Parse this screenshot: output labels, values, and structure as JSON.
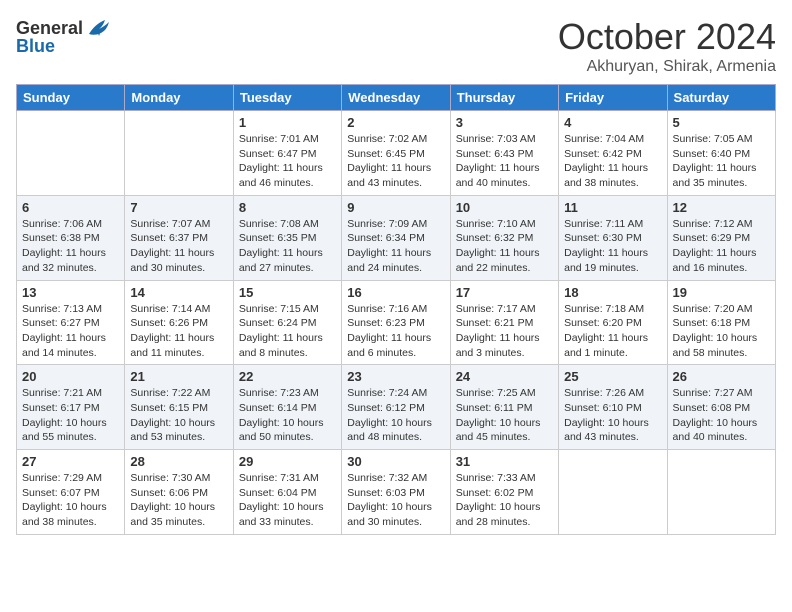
{
  "header": {
    "logo_general": "General",
    "logo_blue": "Blue",
    "month_title": "October 2024",
    "location": "Akhuryan, Shirak, Armenia"
  },
  "columns": [
    "Sunday",
    "Monday",
    "Tuesday",
    "Wednesday",
    "Thursday",
    "Friday",
    "Saturday"
  ],
  "weeks": [
    [
      {
        "day": "",
        "sunrise": "",
        "sunset": "",
        "daylight": ""
      },
      {
        "day": "",
        "sunrise": "",
        "sunset": "",
        "daylight": ""
      },
      {
        "day": "1",
        "sunrise": "Sunrise: 7:01 AM",
        "sunset": "Sunset: 6:47 PM",
        "daylight": "Daylight: 11 hours and 46 minutes."
      },
      {
        "day": "2",
        "sunrise": "Sunrise: 7:02 AM",
        "sunset": "Sunset: 6:45 PM",
        "daylight": "Daylight: 11 hours and 43 minutes."
      },
      {
        "day": "3",
        "sunrise": "Sunrise: 7:03 AM",
        "sunset": "Sunset: 6:43 PM",
        "daylight": "Daylight: 11 hours and 40 minutes."
      },
      {
        "day": "4",
        "sunrise": "Sunrise: 7:04 AM",
        "sunset": "Sunset: 6:42 PM",
        "daylight": "Daylight: 11 hours and 38 minutes."
      },
      {
        "day": "5",
        "sunrise": "Sunrise: 7:05 AM",
        "sunset": "Sunset: 6:40 PM",
        "daylight": "Daylight: 11 hours and 35 minutes."
      }
    ],
    [
      {
        "day": "6",
        "sunrise": "Sunrise: 7:06 AM",
        "sunset": "Sunset: 6:38 PM",
        "daylight": "Daylight: 11 hours and 32 minutes."
      },
      {
        "day": "7",
        "sunrise": "Sunrise: 7:07 AM",
        "sunset": "Sunset: 6:37 PM",
        "daylight": "Daylight: 11 hours and 30 minutes."
      },
      {
        "day": "8",
        "sunrise": "Sunrise: 7:08 AM",
        "sunset": "Sunset: 6:35 PM",
        "daylight": "Daylight: 11 hours and 27 minutes."
      },
      {
        "day": "9",
        "sunrise": "Sunrise: 7:09 AM",
        "sunset": "Sunset: 6:34 PM",
        "daylight": "Daylight: 11 hours and 24 minutes."
      },
      {
        "day": "10",
        "sunrise": "Sunrise: 7:10 AM",
        "sunset": "Sunset: 6:32 PM",
        "daylight": "Daylight: 11 hours and 22 minutes."
      },
      {
        "day": "11",
        "sunrise": "Sunrise: 7:11 AM",
        "sunset": "Sunset: 6:30 PM",
        "daylight": "Daylight: 11 hours and 19 minutes."
      },
      {
        "day": "12",
        "sunrise": "Sunrise: 7:12 AM",
        "sunset": "Sunset: 6:29 PM",
        "daylight": "Daylight: 11 hours and 16 minutes."
      }
    ],
    [
      {
        "day": "13",
        "sunrise": "Sunrise: 7:13 AM",
        "sunset": "Sunset: 6:27 PM",
        "daylight": "Daylight: 11 hours and 14 minutes."
      },
      {
        "day": "14",
        "sunrise": "Sunrise: 7:14 AM",
        "sunset": "Sunset: 6:26 PM",
        "daylight": "Daylight: 11 hours and 11 minutes."
      },
      {
        "day": "15",
        "sunrise": "Sunrise: 7:15 AM",
        "sunset": "Sunset: 6:24 PM",
        "daylight": "Daylight: 11 hours and 8 minutes."
      },
      {
        "day": "16",
        "sunrise": "Sunrise: 7:16 AM",
        "sunset": "Sunset: 6:23 PM",
        "daylight": "Daylight: 11 hours and 6 minutes."
      },
      {
        "day": "17",
        "sunrise": "Sunrise: 7:17 AM",
        "sunset": "Sunset: 6:21 PM",
        "daylight": "Daylight: 11 hours and 3 minutes."
      },
      {
        "day": "18",
        "sunrise": "Sunrise: 7:18 AM",
        "sunset": "Sunset: 6:20 PM",
        "daylight": "Daylight: 11 hours and 1 minute."
      },
      {
        "day": "19",
        "sunrise": "Sunrise: 7:20 AM",
        "sunset": "Sunset: 6:18 PM",
        "daylight": "Daylight: 10 hours and 58 minutes."
      }
    ],
    [
      {
        "day": "20",
        "sunrise": "Sunrise: 7:21 AM",
        "sunset": "Sunset: 6:17 PM",
        "daylight": "Daylight: 10 hours and 55 minutes."
      },
      {
        "day": "21",
        "sunrise": "Sunrise: 7:22 AM",
        "sunset": "Sunset: 6:15 PM",
        "daylight": "Daylight: 10 hours and 53 minutes."
      },
      {
        "day": "22",
        "sunrise": "Sunrise: 7:23 AM",
        "sunset": "Sunset: 6:14 PM",
        "daylight": "Daylight: 10 hours and 50 minutes."
      },
      {
        "day": "23",
        "sunrise": "Sunrise: 7:24 AM",
        "sunset": "Sunset: 6:12 PM",
        "daylight": "Daylight: 10 hours and 48 minutes."
      },
      {
        "day": "24",
        "sunrise": "Sunrise: 7:25 AM",
        "sunset": "Sunset: 6:11 PM",
        "daylight": "Daylight: 10 hours and 45 minutes."
      },
      {
        "day": "25",
        "sunrise": "Sunrise: 7:26 AM",
        "sunset": "Sunset: 6:10 PM",
        "daylight": "Daylight: 10 hours and 43 minutes."
      },
      {
        "day": "26",
        "sunrise": "Sunrise: 7:27 AM",
        "sunset": "Sunset: 6:08 PM",
        "daylight": "Daylight: 10 hours and 40 minutes."
      }
    ],
    [
      {
        "day": "27",
        "sunrise": "Sunrise: 7:29 AM",
        "sunset": "Sunset: 6:07 PM",
        "daylight": "Daylight: 10 hours and 38 minutes."
      },
      {
        "day": "28",
        "sunrise": "Sunrise: 7:30 AM",
        "sunset": "Sunset: 6:06 PM",
        "daylight": "Daylight: 10 hours and 35 minutes."
      },
      {
        "day": "29",
        "sunrise": "Sunrise: 7:31 AM",
        "sunset": "Sunset: 6:04 PM",
        "daylight": "Daylight: 10 hours and 33 minutes."
      },
      {
        "day": "30",
        "sunrise": "Sunrise: 7:32 AM",
        "sunset": "Sunset: 6:03 PM",
        "daylight": "Daylight: 10 hours and 30 minutes."
      },
      {
        "day": "31",
        "sunrise": "Sunrise: 7:33 AM",
        "sunset": "Sunset: 6:02 PM",
        "daylight": "Daylight: 10 hours and 28 minutes."
      },
      {
        "day": "",
        "sunrise": "",
        "sunset": "",
        "daylight": ""
      },
      {
        "day": "",
        "sunrise": "",
        "sunset": "",
        "daylight": ""
      }
    ]
  ]
}
